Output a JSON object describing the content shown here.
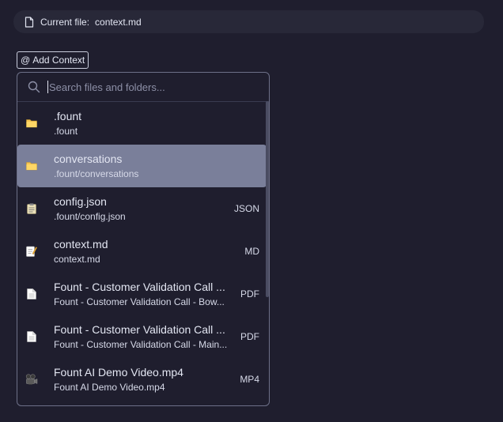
{
  "current_file": {
    "label": "Current file:",
    "name": "context.md"
  },
  "add_context": {
    "at": "@",
    "label": "Add Context"
  },
  "search": {
    "placeholder": "Search files and folders..."
  },
  "items": [
    {
      "title": ".fount",
      "subtitle": ".fount",
      "type": "",
      "icon": "folder-icon",
      "selected": false
    },
    {
      "title": "conversations",
      "subtitle": ".fount/conversations",
      "type": "",
      "icon": "folder-icon",
      "selected": true
    },
    {
      "title": "config.json",
      "subtitle": ".fount/config.json",
      "type": "JSON",
      "icon": "clipboard-icon",
      "selected": false
    },
    {
      "title": "context.md",
      "subtitle": "context.md",
      "type": "MD",
      "icon": "memo-icon",
      "selected": false
    },
    {
      "title": "Fount - Customer Validation Call ...",
      "subtitle": "Fount - Customer Validation Call - Bow...",
      "type": "PDF",
      "icon": "document-icon",
      "selected": false
    },
    {
      "title": "Fount - Customer Validation Call ...",
      "subtitle": "Fount - Customer Validation Call - Main...",
      "type": "PDF",
      "icon": "document-icon",
      "selected": false
    },
    {
      "title": "Fount AI Demo Video.mp4",
      "subtitle": "Fount AI Demo Video.mp4",
      "type": "MP4",
      "icon": "film-projector-icon",
      "selected": false
    }
  ],
  "colors": {
    "background": "#1f1e2e",
    "selected": "#7a7f9a",
    "folder": "#f5c451"
  }
}
